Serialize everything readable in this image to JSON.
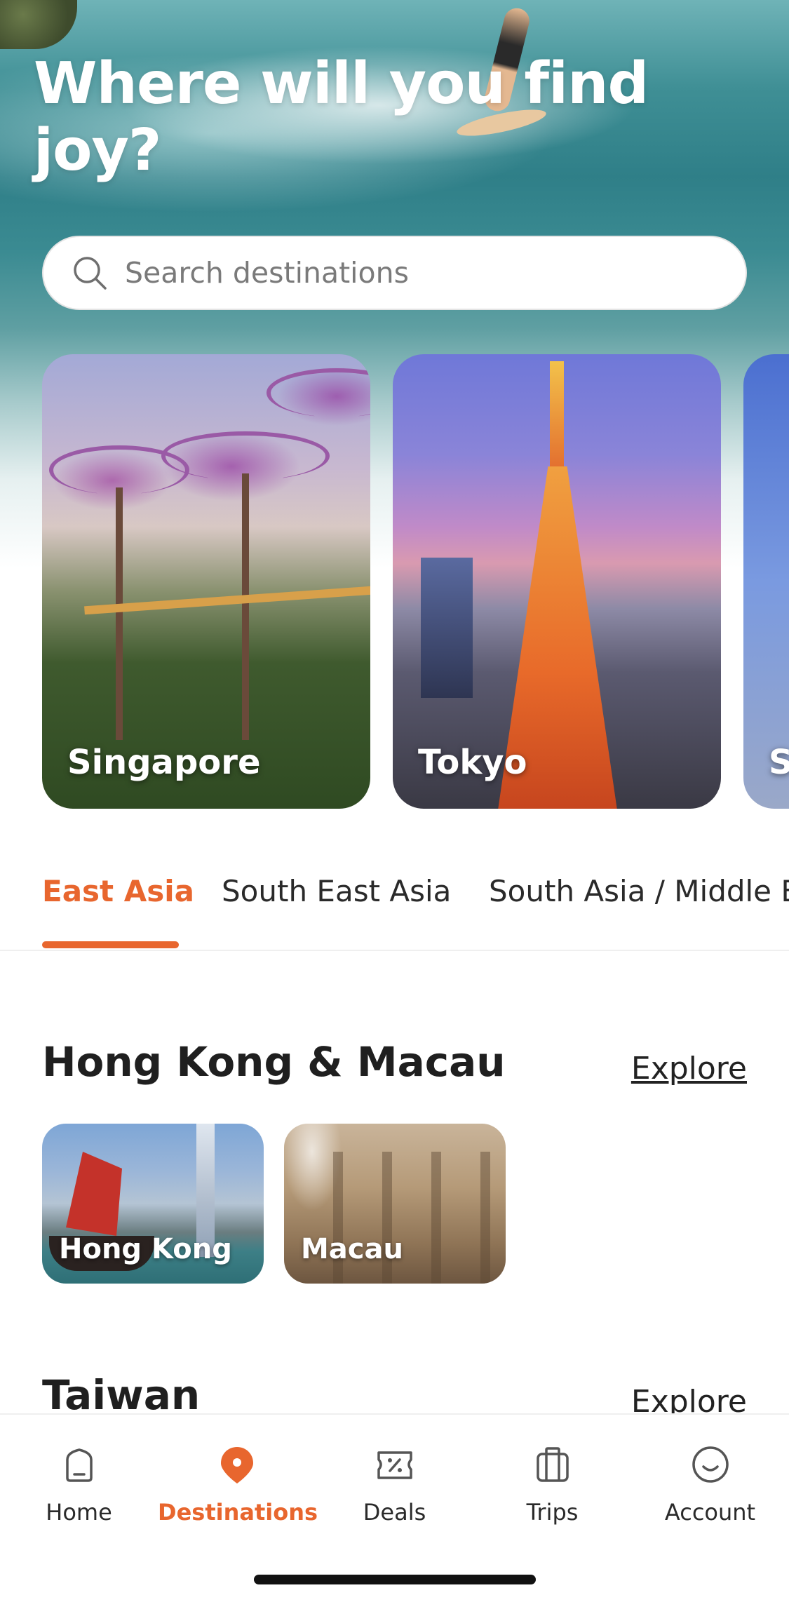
{
  "hero": {
    "title": "Where will you find joy?"
  },
  "search": {
    "placeholder": "Search destinations",
    "icon": "search-icon"
  },
  "featured_cities": [
    {
      "name": "Singapore"
    },
    {
      "name": "Tokyo"
    },
    {
      "name": "S"
    }
  ],
  "region_tabs": [
    {
      "label": "East Asia",
      "active": true
    },
    {
      "label": "South East Asia",
      "active": false
    },
    {
      "label": "South Asia / Middle E",
      "active": false
    }
  ],
  "sections": [
    {
      "title": "Hong Kong & Macau",
      "explore_label": "Explore",
      "destinations": [
        {
          "name": "Hong Kong"
        },
        {
          "name": "Macau"
        }
      ]
    },
    {
      "title": "Taiwan",
      "explore_label": "Explore"
    }
  ],
  "bottom_nav": [
    {
      "label": "Home",
      "icon": "home-icon",
      "active": false
    },
    {
      "label": "Destinations",
      "icon": "location-pin-icon",
      "active": true
    },
    {
      "label": "Deals",
      "icon": "discount-ticket-icon",
      "active": false
    },
    {
      "label": "Trips",
      "icon": "suitcase-icon",
      "active": false
    },
    {
      "label": "Account",
      "icon": "smiley-icon",
      "active": false
    }
  ],
  "colors": {
    "accent": "#e8662e",
    "text": "#222222",
    "white": "#ffffff"
  }
}
